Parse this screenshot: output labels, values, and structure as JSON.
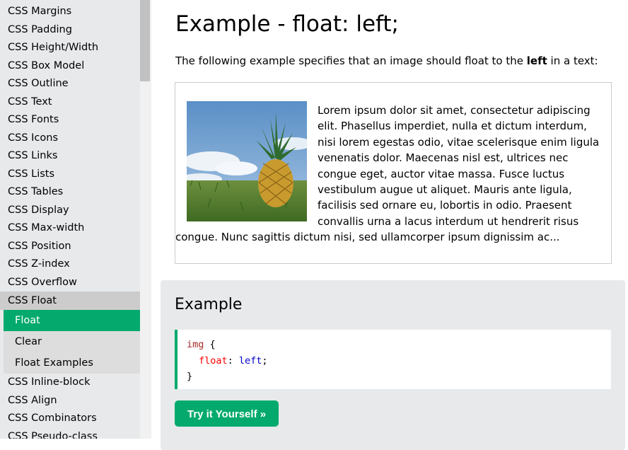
{
  "sidebar": {
    "items_before": [
      "CSS Margins",
      "CSS Padding",
      "CSS Height/Width",
      "CSS Box Model",
      "CSS Outline",
      "CSS Text",
      "CSS Fonts",
      "CSS Icons",
      "CSS Links",
      "CSS Lists",
      "CSS Tables",
      "CSS Display",
      "CSS Max-width",
      "CSS Position",
      "CSS Z-index",
      "CSS Overflow"
    ],
    "active_parent": "CSS Float",
    "sub_items": [
      "Float",
      "Clear",
      "Float Examples"
    ],
    "current_sub_item": "Float",
    "items_after": [
      "CSS Inline-block",
      "CSS Align",
      "CSS Combinators",
      "CSS Pseudo-class"
    ]
  },
  "main": {
    "title": "Example - float: left;",
    "intro_before": "The following example specifies that an image should float to the ",
    "intro_bold": "left",
    "intro_after": " in a text:",
    "demo_text": "Lorem ipsum dolor sit amet, consectetur adipiscing elit. Phasellus imperdiet, nulla et dictum interdum, nisi lorem egestas odio, vitae scelerisque enim ligula venenatis dolor. Maecenas nisl est, ultrices nec congue eget, auctor vitae massa. Fusce luctus vestibulum augue ut aliquet. Mauris ante ligula, facilisis sed ornare eu, lobortis in odio. Praesent convallis urna a lacus interdum ut hendrerit risus congue. Nunc sagittis dictum nisi, sed ullamcorper ipsum dignissim ac...",
    "example": {
      "heading": "Example",
      "code": {
        "selector": "img",
        "open_brace": " {",
        "property": "float",
        "colon": ": ",
        "value": "left",
        "semicolon": ";",
        "close_brace": "}"
      },
      "try_button": "Try it Yourself »"
    }
  },
  "colors": {
    "accent": "#04aa6d",
    "sidebar_bg": "#e7e9eb",
    "active_parent_bg": "#cccccc",
    "sub_nav_bg": "#dddddd"
  }
}
